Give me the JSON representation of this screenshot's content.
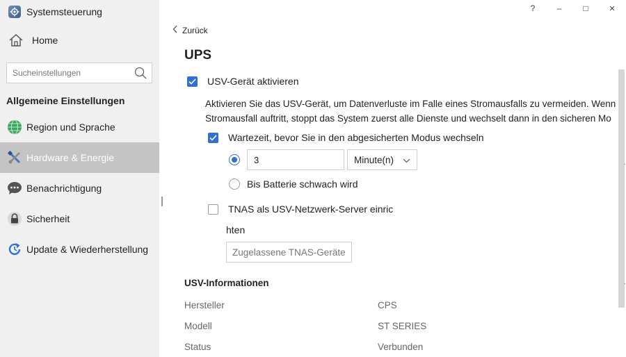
{
  "app": {
    "title": "Systemsteuerung"
  },
  "window_controls": {
    "help": "?",
    "minimize": "–",
    "maximize": "□",
    "close": "×"
  },
  "sidebar": {
    "home": "Home",
    "search_placeholder": "Sucheinstellungen",
    "section_heading": "Allgemeine Einstellungen",
    "items": [
      {
        "label": "Region und Sprache",
        "icon": "globe-icon",
        "active": false
      },
      {
        "label": "Hardware & Energie",
        "icon": "tools-icon",
        "active": true
      },
      {
        "label": "Benachrichtigung",
        "icon": "chat-icon",
        "active": false
      },
      {
        "label": "Sicherheit",
        "icon": "lock-icon",
        "active": false
      },
      {
        "label": "Update & Wiederherstellung",
        "icon": "refresh-icon",
        "active": false
      }
    ]
  },
  "main": {
    "back_label": "Zurück",
    "title": "UPS",
    "enable_ups": {
      "label": "USV-Gerät aktivieren",
      "checked": true
    },
    "description_line1": "Aktivieren Sie das USV-Gerät, um Datenverluste im Falle eines Stromausfalls zu vermeiden. Wenn",
    "description_line2": "Stromausfall auftritt, stoppt das System zuerst alle Dienste und wechselt dann in den sicheren Mo",
    "wait_time": {
      "label": "Wartezeit, bevor Sie in den abgesicherten Modus wechseln",
      "checked": true
    },
    "timer_option": {
      "value": "3",
      "unit": "Minute(n)",
      "selected": true
    },
    "battery_low_option": {
      "label": "Bis Batterie schwach wird",
      "selected": false
    },
    "network_server": {
      "label": "TNAS als USV-Netzwerk-Server einric",
      "label_cont": "hten",
      "checked": false
    },
    "allowed_devices_button": "Zugelassene TNAS-Geräte",
    "info_heading": "USV-Informationen",
    "info": [
      {
        "label": "Hersteller",
        "value": "CPS"
      },
      {
        "label": "Modell",
        "value": "ST SERIES"
      },
      {
        "label": "Status",
        "value": "Verbunden"
      }
    ]
  },
  "colors": {
    "accent": "#2f6fd6",
    "sidebar_bg": "#f0f0f0",
    "active_bg": "#c4c4c4"
  }
}
